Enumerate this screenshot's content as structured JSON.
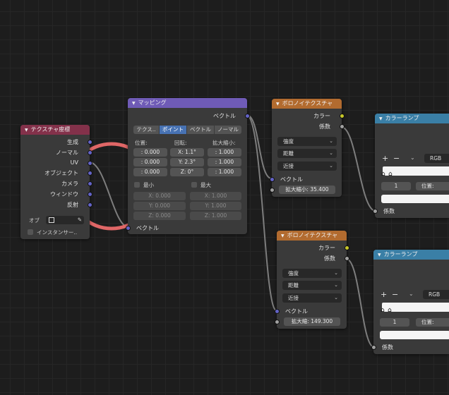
{
  "colors": {
    "header_input": "#83314a",
    "header_vector": "#6f5bb6",
    "header_texture": "#b26b2f",
    "header_converter": "#3a7fa6",
    "socket_vector": "#6363c7",
    "socket_float": "#a1a1a1",
    "socket_color": "#c7c729",
    "annotation_circle": "#e06767",
    "active_tab": "#4772b3"
  },
  "texcoord": {
    "title": "テクスチャ座標",
    "outputs": [
      "生成",
      "ノーマル",
      "UV",
      "オブジェクト",
      "カメラ",
      "ウィンドウ",
      "反射"
    ],
    "object_label": "オブ",
    "instancer_label": "インスタンサー.."
  },
  "mapping": {
    "title": "マッピング",
    "output_label": "ベクトル",
    "tabs": [
      "テクス..",
      "ポイント",
      "ベクトル",
      "ノーマル"
    ],
    "active_tab": "ポイント",
    "location_label": "位置:",
    "rotation_label": "回転:",
    "scale_label": "拡大縮小:",
    "location": [
      ": 0.000",
      ": 0.000",
      ": 0.000"
    ],
    "rotation": [
      "X:   1.1°",
      "Y:   2.3°",
      "Z:     0°"
    ],
    "scale": [
      ": 1.000",
      ": 1.000",
      ": 1.000"
    ],
    "min_label": "最小",
    "max_label": "最大",
    "min": [
      "X:        0.000",
      "Y:        0.000",
      "Z:        0.000"
    ],
    "max": [
      "X:        1.000",
      "Y:        1.000",
      "Z:        1.000"
    ],
    "input_label": "ベクトル"
  },
  "voronoi1": {
    "title": "ボロノイテクスチャ",
    "outputs": [
      "カラー",
      "係数"
    ],
    "dropdowns": [
      "強度",
      "距離",
      "近接"
    ],
    "input_label": "ベクトル",
    "scale_field": "拡大縮小: 35.400"
  },
  "voronoi2": {
    "title": "ボロノイテクスチャ",
    "outputs": [
      "カラー",
      "係数"
    ],
    "dropdowns": [
      "強度",
      "距離",
      "近接"
    ],
    "input_label": "ベクトル",
    "scale_field": "拡大縮: 149.300"
  },
  "ramp1": {
    "title": "カラーランプ",
    "plus": "+",
    "minus": "−",
    "mode": "RGB",
    "index": "1",
    "position_label": "位置:",
    "input_label": "係数"
  },
  "ramp2": {
    "title": "カラーランプ",
    "plus": "+",
    "minus": "−",
    "mode": "RGB",
    "index": "1",
    "position_label": "位置:",
    "input_label": "係数"
  }
}
